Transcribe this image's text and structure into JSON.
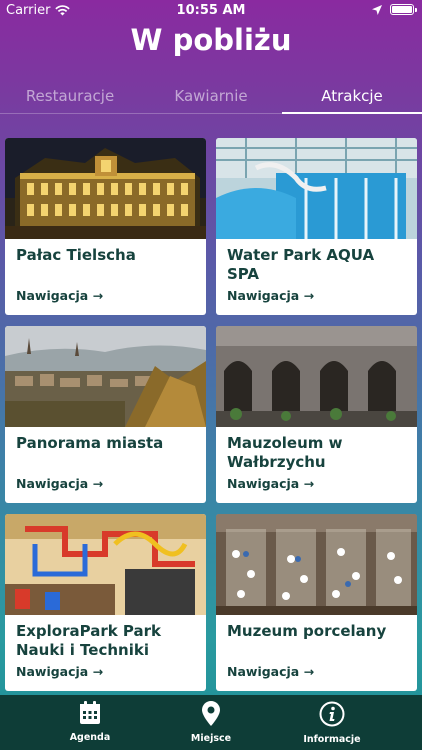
{
  "status": {
    "carrier": "Carrier",
    "time": "10:55 AM"
  },
  "header": {
    "title": "W pobliżu"
  },
  "tabs": [
    {
      "label": "Restauracje"
    },
    {
      "label": "Kawiarnie"
    },
    {
      "label": "Atrakcje"
    }
  ],
  "active_tab": "Atrakcje",
  "cards": [
    {
      "title": "Pałac Tielscha",
      "nav": "Nawigacja →",
      "image": "palace-night-photo"
    },
    {
      "title": "Water Park AQUA SPA",
      "nav": "Nawigacja →",
      "image": "water-park-pool-photo"
    },
    {
      "title": "Panorama miasta",
      "nav": "Nawigacja →",
      "image": "city-panorama-photo"
    },
    {
      "title": "Mauzoleum w Wałbrzychu",
      "nav": "Nawigacja →",
      "image": "mausoleum-arches-photo"
    },
    {
      "title": "ExploraPark Park Nauki i Techniki",
      "nav": "Nawigacja →",
      "image": "science-park-photo"
    },
    {
      "title": "Muzeum porcelany",
      "nav": "Nawigacja →",
      "image": "porcelain-museum-photo"
    }
  ],
  "bottom_nav": [
    {
      "label": "Agenda",
      "icon": "calendar-icon"
    },
    {
      "label": "Miejsce",
      "icon": "map-pin-icon"
    },
    {
      "label": "Informacje",
      "icon": "info-icon"
    }
  ]
}
